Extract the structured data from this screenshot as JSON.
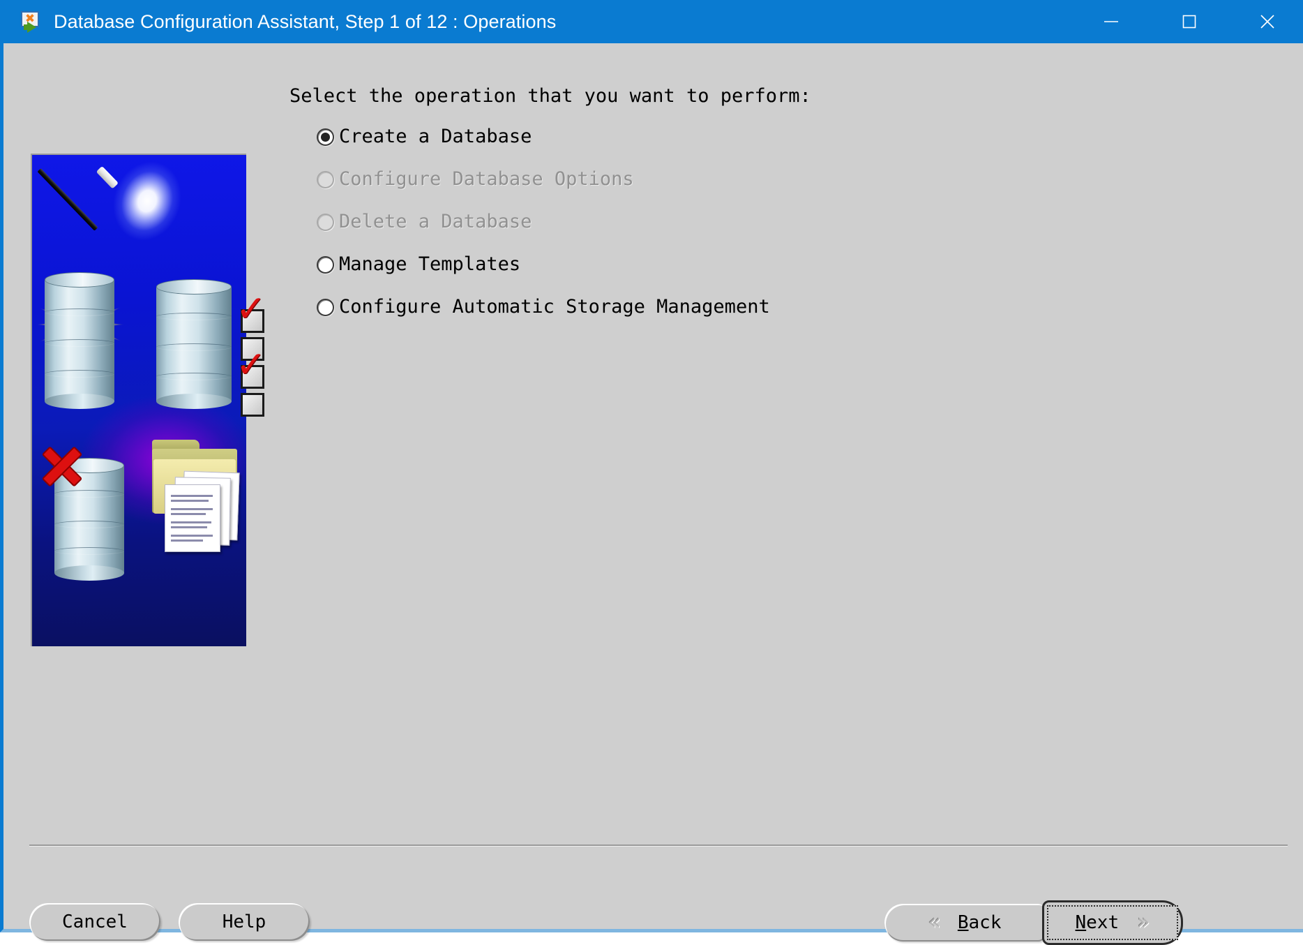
{
  "window": {
    "title": "Database Configuration Assistant, Step 1 of 12 : Operations",
    "icon": "oracle-dbca-icon",
    "titlebar_color": "#0a7bd1",
    "background_color": "#cfcfcf",
    "controls": [
      {
        "name": "minimize",
        "glyph": "minimize-icon"
      },
      {
        "name": "maximize",
        "glyph": "maximize-icon"
      },
      {
        "name": "close",
        "glyph": "close-icon"
      }
    ]
  },
  "side_graphic": {
    "alt": "wizard-wand-database-illustration",
    "background_colors": [
      "#0f17e8",
      "#0a1060",
      "#9600dc"
    ]
  },
  "main": {
    "prompt": "Select the operation that you want to perform:",
    "options": [
      {
        "label": "Create a Database",
        "selected": true,
        "enabled": true
      },
      {
        "label": "Configure Database Options",
        "selected": false,
        "enabled": false
      },
      {
        "label": "Delete a Database",
        "selected": false,
        "enabled": false
      },
      {
        "label": "Manage Templates",
        "selected": false,
        "enabled": true
      },
      {
        "label": "Configure Automatic Storage Management",
        "selected": false,
        "enabled": true
      }
    ]
  },
  "footer": {
    "cancel_label": "Cancel",
    "help_label": "Help",
    "back": {
      "mnemonic": "B",
      "rest": "ack",
      "chevron": "«"
    },
    "next": {
      "mnemonic": "N",
      "rest": "ext",
      "chevron": "»",
      "is_default": true
    }
  }
}
